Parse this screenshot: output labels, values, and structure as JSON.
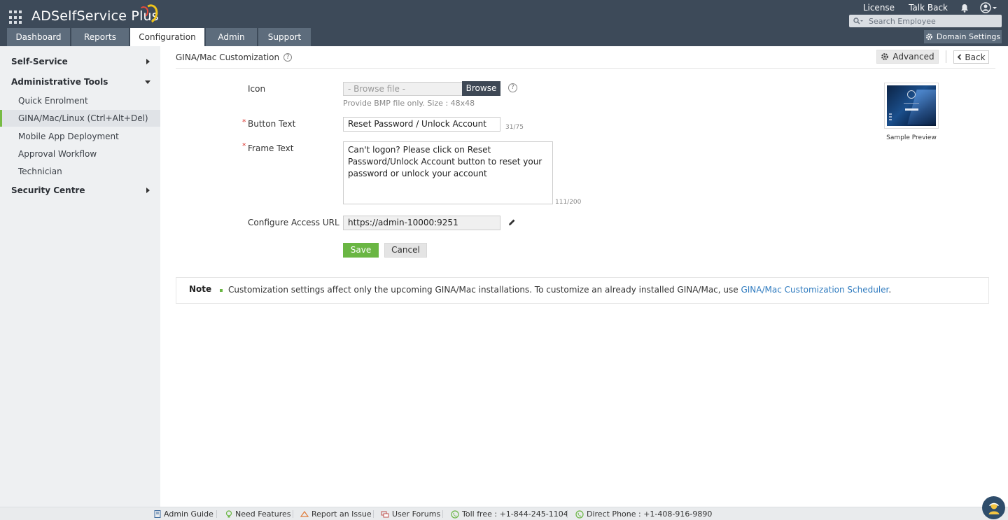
{
  "app": {
    "name": "ADSelfService Plus",
    "top_links": [
      "License",
      "Talk Back"
    ],
    "search_placeholder": "Search Employee",
    "domain_settings": "Domain Settings"
  },
  "tabs": [
    {
      "label": "Dashboard",
      "active": false
    },
    {
      "label": "Reports",
      "active": false
    },
    {
      "label": "Configuration",
      "active": true
    },
    {
      "label": "Admin",
      "active": false
    },
    {
      "label": "Support",
      "active": false
    }
  ],
  "sidebar": {
    "items": [
      {
        "label": "Self-Service",
        "type": "header",
        "state": "collapsed"
      },
      {
        "label": "Administrative Tools",
        "type": "header",
        "state": "expanded"
      },
      {
        "label": "Quick Enrolment",
        "type": "sub"
      },
      {
        "label": "GINA/Mac/Linux (Ctrl+Alt+Del)",
        "type": "sub",
        "selected": true
      },
      {
        "label": "Mobile App Deployment",
        "type": "sub"
      },
      {
        "label": "Approval Workflow",
        "type": "sub"
      },
      {
        "label": "Technician",
        "type": "sub"
      },
      {
        "label": "Security Centre",
        "type": "header",
        "state": "collapsed"
      }
    ]
  },
  "page": {
    "title": "GINA/Mac Customization",
    "advanced_label": "Advanced",
    "back_label": "Back"
  },
  "form": {
    "icon": {
      "label": "Icon",
      "placeholder": "- Browse file -",
      "browse_label": "Browse",
      "hint": "Provide BMP file only. Size : 48x48"
    },
    "button_text": {
      "label": "Button Text",
      "value": "Reset Password / Unlock Account",
      "counter": "31/75"
    },
    "frame_text": {
      "label": "Frame Text",
      "value": "Can't logon? Please click on Reset Password/Unlock Account button to reset your password or unlock your account",
      "counter": "111/200"
    },
    "access_url": {
      "label": "Configure Access URL",
      "value": "https://admin-10000:9251"
    },
    "save_label": "Save",
    "cancel_label": "Cancel"
  },
  "preview": {
    "caption": "Sample Preview"
  },
  "note": {
    "title": "Note",
    "text": "Customization settings affect only the upcoming GINA/Mac installations. To customize an already installed GINA/Mac, use ",
    "link": "GINA/Mac Customization Scheduler",
    "suffix": "."
  },
  "footer": {
    "admin_guide": "Admin Guide",
    "need_features": "Need Features",
    "report_issue": "Report an Issue",
    "user_forums": "User Forums",
    "toll_free": "Toll free : +1-844-245-1104",
    "direct_phone": "Direct Phone : +1-408-916-9890"
  },
  "colors": {
    "header_bg": "#3d4a59",
    "tab_bg": "#5d6c7c",
    "accent_green": "#6ab643",
    "link_blue": "#2f7bbf",
    "required_red": "#d9312a"
  }
}
